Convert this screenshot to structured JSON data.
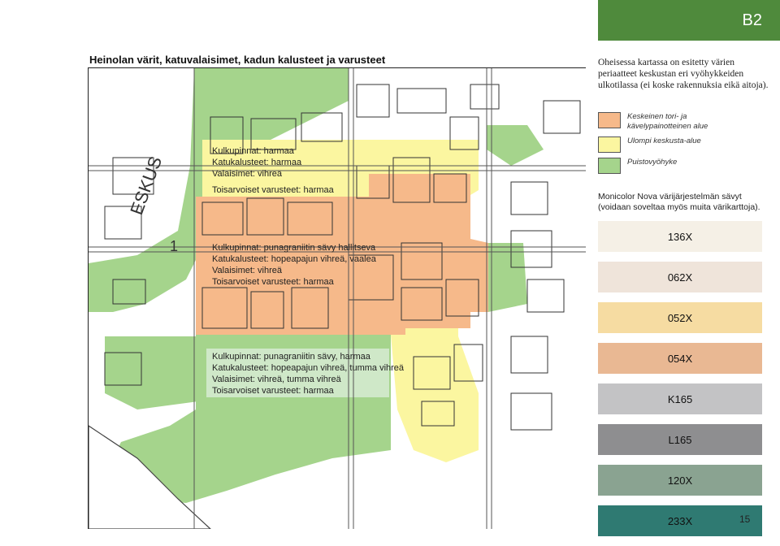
{
  "badge": "B2",
  "title": "Heinolan värit, katuvalaisimet, kadun kalusteet ja varusteet",
  "intro": "Oheisessa kartassa on esitetty värien periaatteet keskustan eri vyöhykkeiden ulkotilassa (ei koske rakennuksia eikä aitoja).",
  "legend": [
    {
      "label": "Keskeinen tori- ja kävelypainotteinen alue",
      "color": "#f6b98a"
    },
    {
      "label": "Ulompi keskusta-alue",
      "color": "#fbf6a0"
    },
    {
      "label": "Puistovyöhyke",
      "color": "#a5d48c"
    }
  ],
  "monicolor_note": "Monicolor Nova värijärjestelmän sävyt (voidaan soveltaa myös muita värikarttoja).",
  "chips": [
    {
      "label": "136X",
      "color": "#f5f0e6"
    },
    {
      "label": "062X",
      "color": "#efe4da"
    },
    {
      "label": "052X",
      "color": "#f6dca2"
    },
    {
      "label": "054X",
      "color": "#e9b893"
    },
    {
      "label": "K165",
      "color": "#c3c3c5"
    },
    {
      "label": "L165",
      "color": "#8e8e90"
    },
    {
      "label": "120X",
      "color": "#8aa391"
    },
    {
      "label": "233X",
      "color": "#2f7a72"
    }
  ],
  "zones": {
    "outer": {
      "line1": "Kulkupinnat:  harmaa",
      "line2": "Katukalusteet: harmaa",
      "line3": "Valaisimet: vihreä",
      "line4": "Toisarvoiset varusteet: harmaa"
    },
    "central": {
      "line1": "Kulkupinnat: punagraniitin sävy hallitseva",
      "line2": "Katukalusteet: hopeapajun vihreä, vaalea",
      "line3": "Valaisimet: vihreä",
      "line4": "Toisarvoiset varusteet: harmaa"
    },
    "park": {
      "line1": "Kulkupinnat: punagraniitin sävy, harmaa",
      "line2": "Katukalusteet: hopeapajun vihreä, tumma vihreä",
      "line3": "Valaisimet: vihreä, tumma vihreä",
      "line4": "Toisarvoiset varusteet: harmaa"
    }
  },
  "map_labels": {
    "eskus": "ESKUS",
    "one": "1"
  },
  "page_number": "15"
}
